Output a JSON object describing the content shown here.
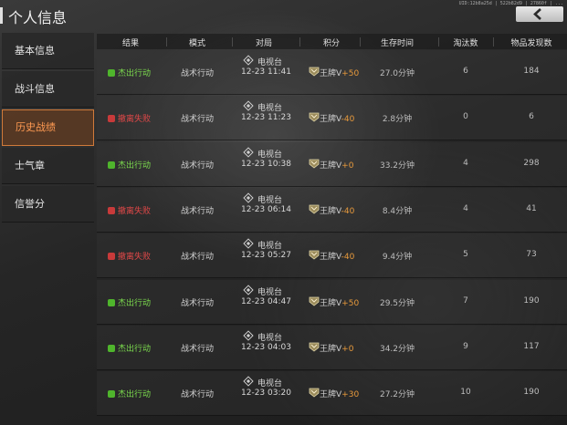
{
  "header": {
    "title": "个人信息",
    "uid": "UID:12b8a25d | 522b82d9 | 27860f | ...",
    "back_icon": "chevron-left-icon"
  },
  "sidebar": {
    "items": [
      {
        "label": "基本信息",
        "active": false
      },
      {
        "label": "战斗信息",
        "active": false
      },
      {
        "label": "历史战绩",
        "active": true
      },
      {
        "label": "士气章",
        "active": false
      },
      {
        "label": "信誉分",
        "active": false
      }
    ]
  },
  "table": {
    "columns": [
      "结果",
      "模式",
      "对局",
      "积分",
      "生存时间",
      "淘汰数",
      "物品发现数"
    ],
    "rows": [
      {
        "result": "杰出行动",
        "win": true,
        "mode": "战术行动",
        "map": "电视台",
        "time": "12-23 11:41",
        "rank": "王牌V",
        "delta": "+50",
        "survival": "27.0分钟",
        "eliminations": "6",
        "items_found": "184"
      },
      {
        "result": "撤离失败",
        "win": false,
        "mode": "战术行动",
        "map": "电视台",
        "time": "12-23 11:23",
        "rank": "王牌V",
        "delta": "-40",
        "survival": "2.8分钟",
        "eliminations": "0",
        "items_found": "6"
      },
      {
        "result": "杰出行动",
        "win": true,
        "mode": "战术行动",
        "map": "电视台",
        "time": "12-23 10:38",
        "rank": "王牌V",
        "delta": "+0",
        "survival": "33.2分钟",
        "eliminations": "4",
        "items_found": "298"
      },
      {
        "result": "撤离失败",
        "win": false,
        "mode": "战术行动",
        "map": "电视台",
        "time": "12-23 06:14",
        "rank": "王牌V",
        "delta": "-40",
        "survival": "8.4分钟",
        "eliminations": "4",
        "items_found": "41"
      },
      {
        "result": "撤离失败",
        "win": false,
        "mode": "战术行动",
        "map": "电视台",
        "time": "12-23 05:27",
        "rank": "王牌V",
        "delta": "-40",
        "survival": "9.4分钟",
        "eliminations": "5",
        "items_found": "73"
      },
      {
        "result": "杰出行动",
        "win": true,
        "mode": "战术行动",
        "map": "电视台",
        "time": "12-23 04:47",
        "rank": "王牌V",
        "delta": "+50",
        "survival": "29.5分钟",
        "eliminations": "7",
        "items_found": "190"
      },
      {
        "result": "杰出行动",
        "win": true,
        "mode": "战术行动",
        "map": "电视台",
        "time": "12-23 04:03",
        "rank": "王牌V",
        "delta": "+0",
        "survival": "34.2分钟",
        "eliminations": "9",
        "items_found": "117"
      },
      {
        "result": "杰出行动",
        "win": true,
        "mode": "战术行动",
        "map": "电视台",
        "time": "12-23 03:20",
        "rank": "王牌V",
        "delta": "+30",
        "survival": "27.2分钟",
        "eliminations": "10",
        "items_found": "190"
      }
    ]
  },
  "colors": {
    "accent_active": "#ff9a52",
    "win": "#7cdc4e",
    "lose": "#e04848",
    "delta": "#e89a3c"
  }
}
